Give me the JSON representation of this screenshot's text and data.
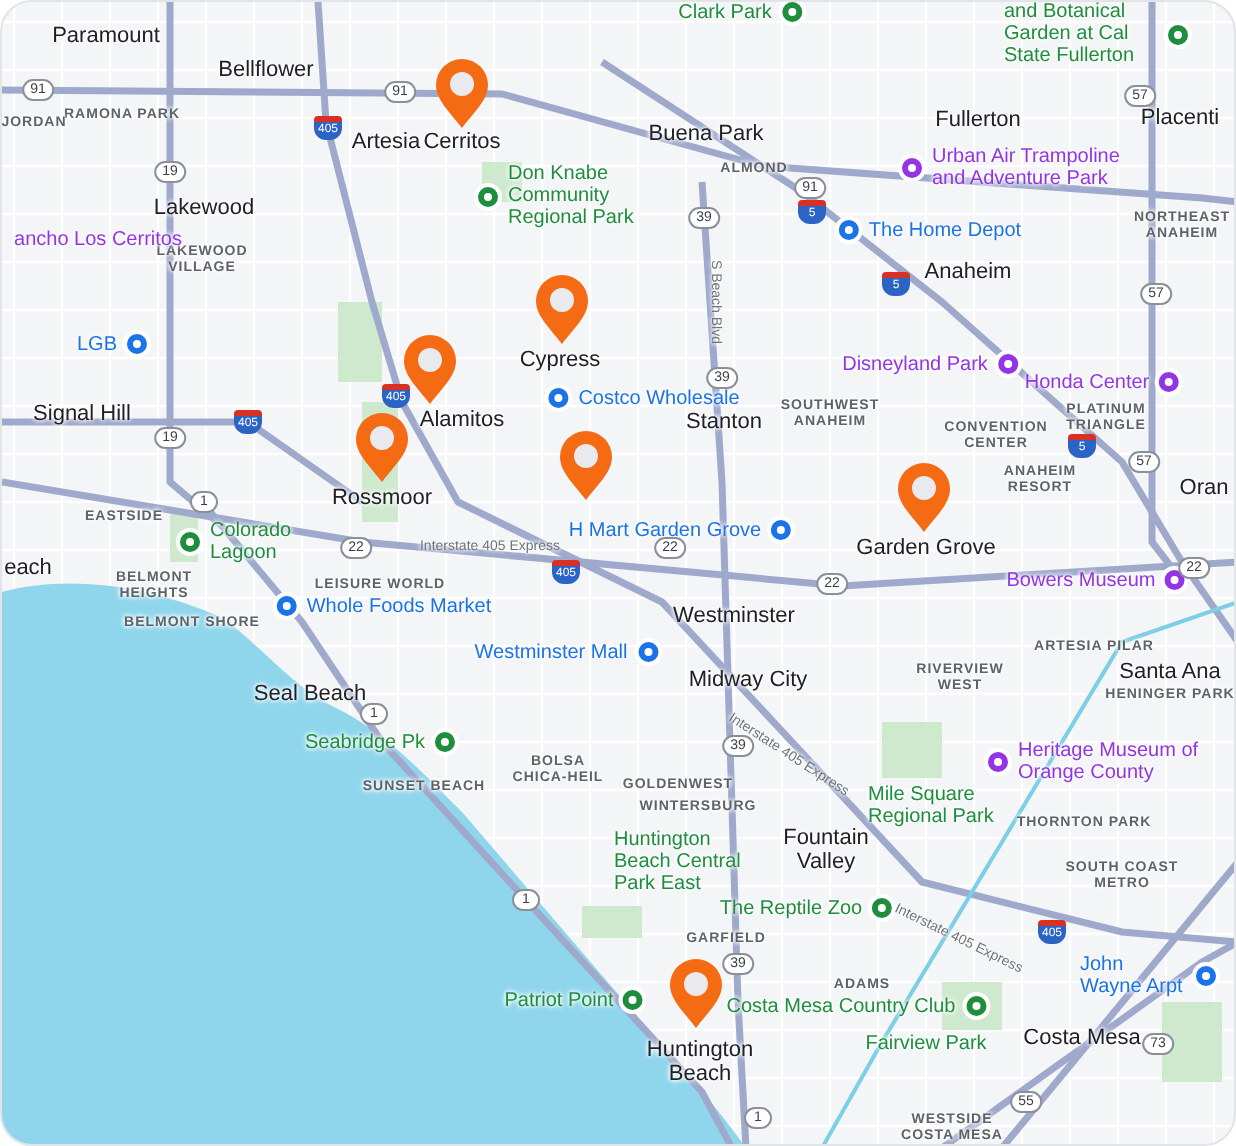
{
  "map": {
    "labels": [
      {
        "text": "Paramount",
        "kind": "city"
      },
      {
        "text": "Bellflower",
        "kind": "city"
      },
      {
        "text": "Artesia",
        "kind": "city"
      },
      {
        "text": "Cerritos",
        "kind": "city"
      },
      {
        "text": "Lakewood",
        "kind": "city"
      },
      {
        "text": "Signal Hill",
        "kind": "city"
      },
      {
        "text": "Cypress",
        "kind": "city"
      },
      {
        "text": "Alamitos",
        "kind": "city"
      },
      {
        "text": "Rossmoor",
        "kind": "city"
      },
      {
        "text": "Buena Park",
        "kind": "city"
      },
      {
        "text": "Stanton",
        "kind": "city"
      },
      {
        "text": "Fullerton",
        "kind": "city"
      },
      {
        "text": "Placenti",
        "kind": "city"
      },
      {
        "text": "Anaheim",
        "kind": "city"
      },
      {
        "text": "Garden Grove",
        "kind": "city"
      },
      {
        "text": "Oran",
        "kind": "city"
      },
      {
        "text": "Santa Ana",
        "kind": "city"
      },
      {
        "text": "Westminster",
        "kind": "city"
      },
      {
        "text": "Midway City",
        "kind": "city"
      },
      {
        "text": "Fountain Valley",
        "kind": "city"
      },
      {
        "text": "Seal Beach",
        "kind": "city"
      },
      {
        "text": "Huntington Beach",
        "kind": "city"
      },
      {
        "text": "Costa Mesa",
        "kind": "city"
      },
      {
        "text": "each",
        "kind": "city"
      },
      {
        "text": "RAMONA PARK",
        "kind": "district"
      },
      {
        "text": "JORDAN",
        "kind": "district"
      },
      {
        "text": "LAKEWOOD VILLAGE",
        "kind": "district"
      },
      {
        "text": "EASTSIDE",
        "kind": "district"
      },
      {
        "text": "BELMONT HEIGHTS",
        "kind": "district"
      },
      {
        "text": "BELMONT SHORE",
        "kind": "district"
      },
      {
        "text": "LEISURE WORLD",
        "kind": "district"
      },
      {
        "text": "SUNSET BEACH",
        "kind": "district"
      },
      {
        "text": "BOLSA CHICA-HEIL",
        "kind": "district"
      },
      {
        "text": "GOLDENWEST",
        "kind": "district"
      },
      {
        "text": "WINTERSBURG",
        "kind": "district"
      },
      {
        "text": "GARFIELD",
        "kind": "district"
      },
      {
        "text": "ADAMS",
        "kind": "district"
      },
      {
        "text": "ALMOND",
        "kind": "district"
      },
      {
        "text": "SOUTHWEST ANAHEIM",
        "kind": "district"
      },
      {
        "text": "CONVENTION CENTER",
        "kind": "district"
      },
      {
        "text": "ANAHEIM RESORT",
        "kind": "district"
      },
      {
        "text": "PLATINUM TRIANGLE",
        "kind": "district"
      },
      {
        "text": "NORTHEAST ANAHEIM",
        "kind": "district"
      },
      {
        "text": "RIVERVIEW WEST",
        "kind": "district"
      },
      {
        "text": "ARTESIA PILAR",
        "kind": "district"
      },
      {
        "text": "HENINGER PARK",
        "kind": "district"
      },
      {
        "text": "THORNTON PARK",
        "kind": "district"
      },
      {
        "text": "SOUTH COAST METRO",
        "kind": "district"
      },
      {
        "text": "WESTSIDE COSTA MESA",
        "kind": "district"
      },
      {
        "text": "Don Knabe Community Regional Park",
        "kind": "poi",
        "color": "#1e8e3e"
      },
      {
        "text": "Colorado Lagoon",
        "kind": "poi",
        "color": "#1e8e3e"
      },
      {
        "text": "Whole Foods Market",
        "kind": "poi",
        "color": "#1a73e8"
      },
      {
        "text": "Westminster Mall",
        "kind": "poi",
        "color": "#1a73e8"
      },
      {
        "text": "Seabridge Pk",
        "kind": "poi",
        "color": "#1e8e3e"
      },
      {
        "text": "Patriot Point",
        "kind": "poi",
        "color": "#1e8e3e"
      },
      {
        "text": "Costco Wholesale",
        "kind": "poi",
        "color": "#1a73e8"
      },
      {
        "text": "H Mart Garden Grove",
        "kind": "poi",
        "color": "#1a73e8"
      },
      {
        "text": "The Home Depot",
        "kind": "poi",
        "color": "#1a73e8"
      },
      {
        "text": "Urban Air Trampoline and Adventure Park",
        "kind": "poi",
        "color": "#9334e6"
      },
      {
        "text": "Disneyland Park",
        "kind": "poi",
        "color": "#9334e6"
      },
      {
        "text": "Honda Center",
        "kind": "poi",
        "color": "#9334e6"
      },
      {
        "text": "Bowers Museum",
        "kind": "poi",
        "color": "#9334e6"
      },
      {
        "text": "Heritage Museum of Orange County",
        "kind": "poi",
        "color": "#9334e6"
      },
      {
        "text": "Mile Square Regional Park",
        "kind": "poi",
        "color": "#1e8e3e"
      },
      {
        "text": "Huntington Beach Central Park East",
        "kind": "poi",
        "color": "#1e8e3e"
      },
      {
        "text": "The Reptile Zoo",
        "kind": "poi",
        "color": "#1e8e3e"
      },
      {
        "text": "Costa Mesa Country Club",
        "kind": "poi",
        "color": "#1e8e3e"
      },
      {
        "text": "Fairview Park",
        "kind": "poi",
        "color": "#1e8e3e"
      },
      {
        "text": "John Wayne Arpt",
        "kind": "poi",
        "color": "#1a73e8"
      },
      {
        "text": "ancho Los Cerritos",
        "kind": "poi",
        "color": "#9334e6"
      },
      {
        "text": "LGB",
        "kind": "poi",
        "color": "#1a73e8"
      },
      {
        "text": "Clark Park",
        "kind": "poi",
        "color": "#1e8e3e"
      },
      {
        "text": "and Botanical Garden at Cal State Fullerton",
        "kind": "poi",
        "color": "#1e8e3e"
      },
      {
        "text": "S Beach Blvd",
        "kind": "road"
      },
      {
        "text": "Interstate 405 Express",
        "kind": "road"
      },
      {
        "text": "Interstate 405 Express",
        "kind": "road"
      },
      {
        "text": "Interstate 405 Express",
        "kind": "road"
      }
    ],
    "shields": [
      {
        "text": "91",
        "kind": "state"
      },
      {
        "text": "91",
        "kind": "state"
      },
      {
        "text": "405",
        "kind": "interstate"
      },
      {
        "text": "19",
        "kind": "state"
      },
      {
        "text": "19",
        "kind": "state"
      },
      {
        "text": "405",
        "kind": "interstate"
      },
      {
        "text": "1",
        "kind": "state"
      },
      {
        "text": "22",
        "kind": "state"
      },
      {
        "text": "405",
        "kind": "interstate"
      },
      {
        "text": "405",
        "kind": "interstate"
      },
      {
        "text": "91",
        "kind": "state"
      },
      {
        "text": "5",
        "kind": "interstate"
      },
      {
        "text": "39",
        "kind": "state"
      },
      {
        "text": "5",
        "kind": "interstate"
      },
      {
        "text": "39",
        "kind": "state"
      },
      {
        "text": "5",
        "kind": "interstate"
      },
      {
        "text": "57",
        "kind": "state"
      },
      {
        "text": "57",
        "kind": "state"
      },
      {
        "text": "57",
        "kind": "state"
      },
      {
        "text": "22",
        "kind": "state"
      },
      {
        "text": "22",
        "kind": "state"
      },
      {
        "text": "22",
        "kind": "state"
      },
      {
        "text": "1",
        "kind": "state"
      },
      {
        "text": "1",
        "kind": "state"
      },
      {
        "text": "39",
        "kind": "state"
      },
      {
        "text": "39",
        "kind": "state"
      },
      {
        "text": "405",
        "kind": "interstate"
      },
      {
        "text": "73",
        "kind": "state"
      },
      {
        "text": "55",
        "kind": "state"
      },
      {
        "text": "1",
        "kind": "state"
      }
    ],
    "pins": [
      {
        "kind": "location"
      },
      {
        "kind": "location"
      },
      {
        "kind": "location"
      },
      {
        "kind": "location"
      },
      {
        "kind": "location"
      },
      {
        "kind": "location"
      },
      {
        "kind": "location"
      }
    ]
  }
}
